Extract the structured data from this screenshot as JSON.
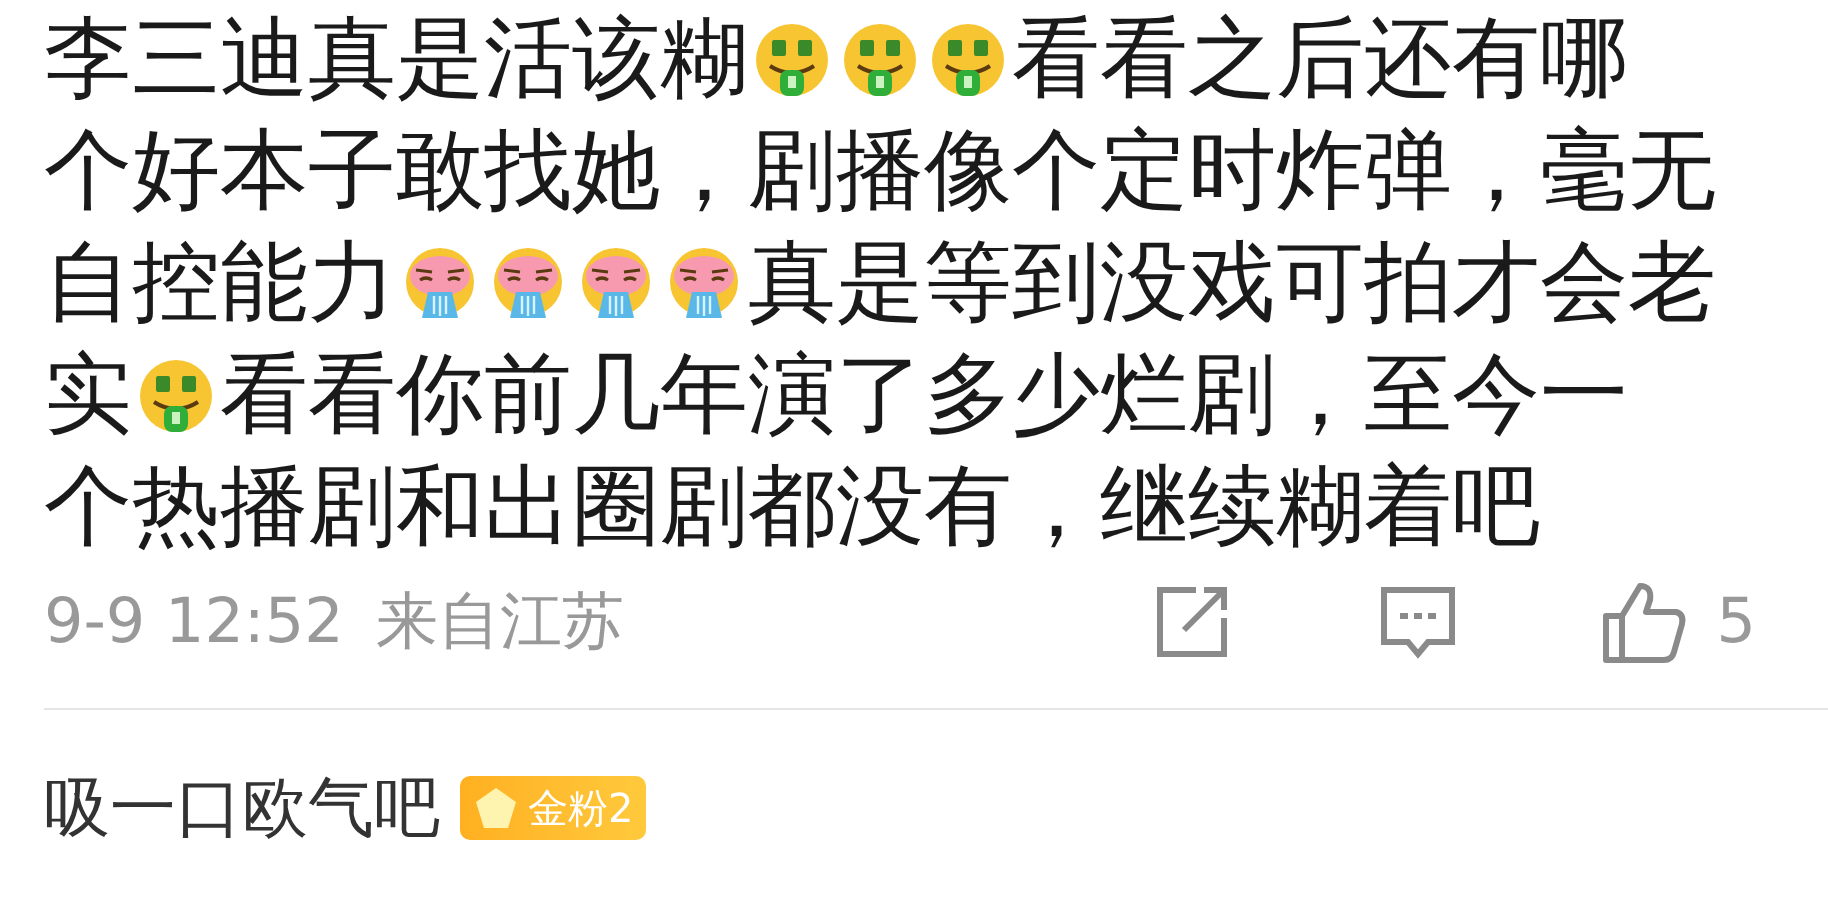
{
  "comment": {
    "lines": [
      [
        {
          "kind": "text",
          "text": "李三迪真是活该糊"
        },
        {
          "kind": "money"
        },
        {
          "kind": "money"
        },
        {
          "kind": "money"
        },
        {
          "kind": "text",
          "text": "看看之后还有哪"
        }
      ],
      [
        {
          "kind": "text",
          "text": "个好本子敢找她，剧播像个定时炸弹，毫无"
        }
      ],
      [
        {
          "kind": "text",
          "text": "自控能力"
        },
        {
          "kind": "spew"
        },
        {
          "kind": "spew"
        },
        {
          "kind": "spew"
        },
        {
          "kind": "spew"
        },
        {
          "kind": "text",
          "text": "真是等到没戏可拍才会老"
        }
      ],
      [
        {
          "kind": "text",
          "text": "实"
        },
        {
          "kind": "money"
        },
        {
          "kind": "text",
          "text": "看看你前几年演了多少烂剧，至今一"
        }
      ],
      [
        {
          "kind": "text",
          "text": "个热播剧和出圈剧都没有，继续糊着吧"
        }
      ]
    ],
    "time": "9-9 12:52",
    "location": "来自江苏",
    "likes": "5"
  },
  "next_comment": {
    "user": "吸一口欧气吧",
    "badge": "金粉2"
  }
}
